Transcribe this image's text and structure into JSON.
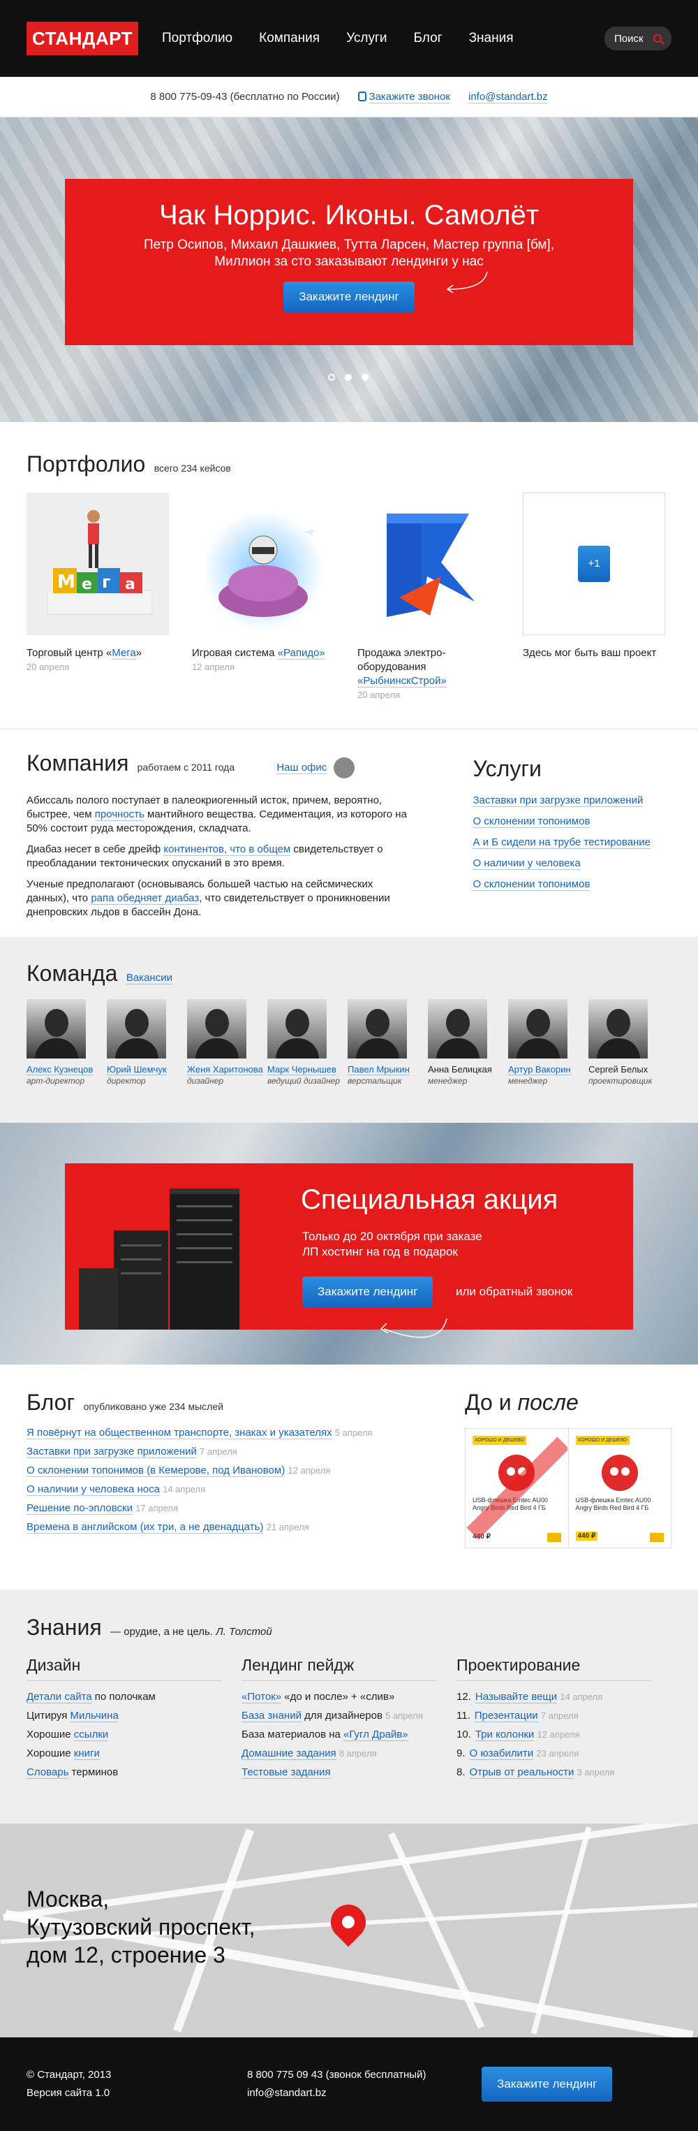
{
  "header": {
    "logo": "СТАНДАРТ",
    "nav": [
      "Портфолио",
      "Компания",
      "Услуги",
      "Блог",
      "Знания"
    ],
    "search_label": "Поиск"
  },
  "contact": {
    "phone": "8 800 775-09-43 (бесплатно по России)",
    "callback": "Закажите звонок",
    "email": "info@standart.bz"
  },
  "hero": {
    "title": "Чак Норрис. Иконы. Самолёт",
    "line1": "Петр Осипов, Михаил Дашкиев, Тутта Ларсен, Мастер группа [бм],",
    "line2": "Миллион за сто заказывают лендинги у нас",
    "button": "Закажите лендинг",
    "slides": 3,
    "active_slide": 1
  },
  "portfolio": {
    "title": "Портфолио",
    "count": "всего 234 кейсов",
    "items": [
      {
        "text1": "Торговый центр «",
        "link": "Мега",
        "text2": "»",
        "date": "20 апреля"
      },
      {
        "text1": "Игровая система ",
        "link": "«Рапидо»",
        "text2": "",
        "date": "12 апреля"
      },
      {
        "text1": "Продажа электро-оборудования ",
        "link": "«РыбнинскСтрой»",
        "text2": "",
        "date": "20 апреля"
      },
      {
        "text1": "Здесь мог быть ваш проект",
        "link": "",
        "text2": "",
        "date": ""
      }
    ],
    "plus_label": "+1"
  },
  "company": {
    "title": "Компания",
    "since": "работаем с 2011 года",
    "office": "Наш офис",
    "p1a": "Абиссаль полого поступает в палеокриогенный исток, причем, вероятно, быстрее, чем ",
    "p1link": "прочность",
    "p1b": " мантийного вещества. Седиментация, из которого на 50% состоит руда месторождения, складчата.",
    "p2a": "Диабаз несет в себе дрейф ",
    "p2link": "континентов, что в общем",
    "p2b": " свидетельствует о преобладании тектонических опусканий в это время.",
    "p3a": "Ученые предполагают (основываясь большей частью на сейсмических данных), что ",
    "p3link": "рапа обедняет диабаз",
    "p3b": ", что свидетельствует о проникновении днепровских льдов в бассейн Дона."
  },
  "services": {
    "title": "Услуги",
    "items": [
      "Заставки при загрузке приложений",
      "О склонении топонимов",
      "А и Б сидели на трубе тестирование",
      "О наличии у человека",
      "О склонении топонимов"
    ]
  },
  "team": {
    "title": "Команда",
    "vacancies": "Вакансии",
    "members": [
      {
        "name": "Алекс Кузнецов",
        "role": "арт-директор",
        "link": true
      },
      {
        "name": "Юрий Шемчук",
        "role": "директор",
        "link": true
      },
      {
        "name": "Женя Харитонова",
        "role": "дизайнер",
        "link": true
      },
      {
        "name": "Марк Чернышев",
        "role": "ведущий дизайнер",
        "link": true
      },
      {
        "name": "Павел Мрыкин",
        "role": "верстальщик",
        "link": true
      },
      {
        "name": "Анна Белицкая",
        "role": "менеджер",
        "link": false
      },
      {
        "name": "Артур Вакорин",
        "role": "менеджер",
        "link": true
      },
      {
        "name": "Сергей Белых",
        "role": "проектировщик",
        "link": false
      }
    ]
  },
  "promo": {
    "title": "Специальная акция",
    "line1": "Только до 20 октября при заказе",
    "line2": "ЛП хостинг на год в подарок",
    "button": "Закажите лендинг",
    "alt": "или обратный звонок"
  },
  "blog": {
    "title": "Блог",
    "count": "опубликовано уже 234 мыслей",
    "posts": [
      {
        "title": "Я повёрнут на общественном транспорте, знаках и указателях",
        "date": "5 апреля"
      },
      {
        "title": "Заставки при загрузке приложений",
        "date": "7 апреля"
      },
      {
        "title": "О склонении топонимов (в Кемерове, под Ивановом)",
        "date": "12 апреля"
      },
      {
        "title": "О наличии у человека носа",
        "date": "14 апреля"
      },
      {
        "title": "Решение по-эпловски",
        "date": "17 апреля"
      },
      {
        "title": "Времена в английском (их три, а не двенадцать)",
        "date": "21 апреля"
      }
    ]
  },
  "before_after": {
    "title_a": "До и ",
    "title_b": "после",
    "tag": "ХОРОШО И ДЕШЕВО",
    "product": "USB-флешка Emtec AU00 Angry Birds Red Bird 4 ГБ",
    "price": "440 ₽"
  },
  "knowledge": {
    "title": "Знания",
    "quote": "— орудие, а не цель.",
    "author": "Л. Толстой",
    "design": {
      "title": "Дизайн",
      "items": [
        {
          "link": "Детали сайта",
          "text": " по полочкам",
          "pre": ""
        },
        {
          "pre": "Цитируя ",
          "link": "Мильчина",
          "text": ""
        },
        {
          "pre": "Хорошие ",
          "link": "ссылки",
          "text": ""
        },
        {
          "pre": "Хорошие ",
          "link": "книги",
          "text": ""
        },
        {
          "pre": "",
          "link": "Словарь",
          "text": " терминов"
        }
      ]
    },
    "landing": {
      "title": "Лендинг пейдж",
      "items": [
        {
          "pre": "",
          "link": "«Поток»",
          "text": " «до и после» + «слив»",
          "date": ""
        },
        {
          "pre": "",
          "link": "База знаний",
          "text": " для дизайнеров",
          "date": "5 апреля"
        },
        {
          "pre": "База материалов на ",
          "link": "«Гугл Драйв»",
          "text": "",
          "date": ""
        },
        {
          "pre": "",
          "link": "Домашние задания",
          "text": "",
          "date": "8 апреля"
        },
        {
          "pre": "",
          "link": "Тестовые задания",
          "text": "",
          "date": ""
        }
      ]
    },
    "projects": {
      "title": "Проектирование",
      "items": [
        {
          "num": "12.",
          "link": "Называйте вещи",
          "date": "14 апреля"
        },
        {
          "num": "11.",
          "link": "Презентации",
          "date": "7 апреля"
        },
        {
          "num": "10.",
          "link": "Три колонки",
          "date": "12 апреля"
        },
        {
          "num": "9.",
          "link": "О юзабилити",
          "date": "23 апреля"
        },
        {
          "num": "8.",
          "link": "Отрыв от реальности",
          "date": "3 апреля"
        }
      ]
    }
  },
  "map": {
    "line1": "Москва,",
    "line2": "Кутузовский проспект,",
    "line3": "дом 12, строение 3"
  },
  "footer": {
    "copyright": "© Стандарт, 2013",
    "version": "Версия сайта 1.0",
    "phone": "8 800 775 09 43 (звонок бесплатный)",
    "email": "info@standart.bz",
    "button": "Закажите лендинг"
  },
  "colors": {
    "brand_red": "#e51b1b",
    "link_blue": "#1565c0",
    "dark": "#101010"
  }
}
